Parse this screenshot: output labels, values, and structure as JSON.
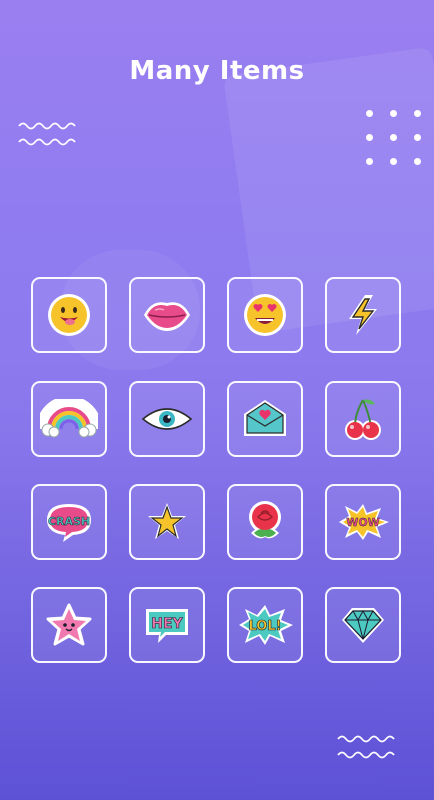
{
  "header": {
    "title": "Many Items"
  },
  "stickers": [
    {
      "name": "smiley-face-sticker",
      "label": ""
    },
    {
      "name": "lips-sticker",
      "label": ""
    },
    {
      "name": "heart-eyes-emoji-sticker",
      "label": ""
    },
    {
      "name": "lightning-bolt-sticker",
      "label": ""
    },
    {
      "name": "rainbow-sticker",
      "label": ""
    },
    {
      "name": "eye-sticker",
      "label": ""
    },
    {
      "name": "love-envelope-sticker",
      "label": ""
    },
    {
      "name": "cherries-sticker",
      "label": ""
    },
    {
      "name": "crash-bubble-sticker",
      "label": "CRASH"
    },
    {
      "name": "star-sticker",
      "label": ""
    },
    {
      "name": "rose-sticker",
      "label": ""
    },
    {
      "name": "wow-burst-sticker",
      "label": "WOW"
    },
    {
      "name": "pink-star-face-sticker",
      "label": ""
    },
    {
      "name": "hey-bubble-sticker",
      "label": "HEY"
    },
    {
      "name": "lol-burst-sticker",
      "label": "LOL!"
    },
    {
      "name": "diamond-sticker",
      "label": ""
    }
  ]
}
